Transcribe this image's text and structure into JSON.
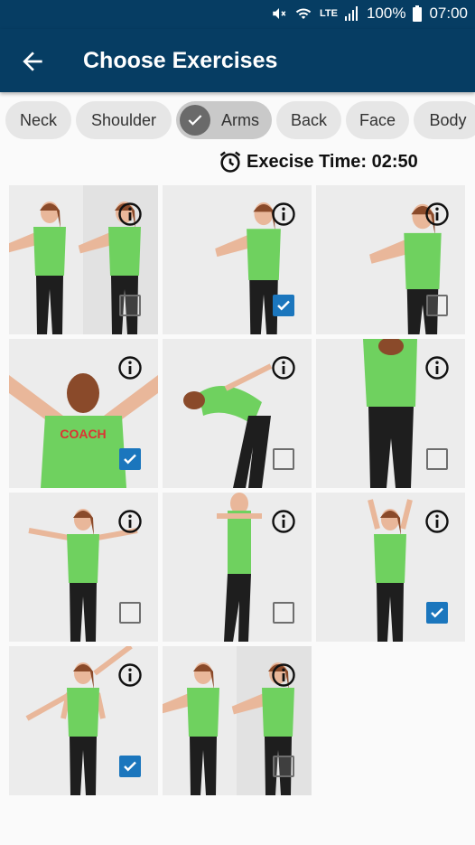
{
  "status": {
    "battery": "100%",
    "time": "07:00",
    "network": "LTE"
  },
  "appbar": {
    "title": "Choose Exercises",
    "back_icon": "arrow-back-icon"
  },
  "categories": [
    {
      "label": "Neck",
      "selected": false
    },
    {
      "label": "Shoulder",
      "selected": false
    },
    {
      "label": "Arms",
      "selected": true
    },
    {
      "label": "Back",
      "selected": false
    },
    {
      "label": "Face",
      "selected": false
    },
    {
      "label": "Body",
      "selected": false
    }
  ],
  "timer": {
    "label": "Execise Time: 02:50",
    "icon": "alarm-clock-icon"
  },
  "exercises": [
    {
      "checked": false,
      "pose": "split"
    },
    {
      "checked": true,
      "pose": "arms-forward"
    },
    {
      "checked": false,
      "pose": "arms-forward-close"
    },
    {
      "checked": true,
      "pose": "back-arms-up"
    },
    {
      "checked": false,
      "pose": "bend-forward"
    },
    {
      "checked": false,
      "pose": "arms-behind-head"
    },
    {
      "checked": false,
      "pose": "arms-side"
    },
    {
      "checked": false,
      "pose": "side-stand"
    },
    {
      "checked": true,
      "pose": "arms-overhead"
    },
    {
      "checked": true,
      "pose": "arms-diagonal"
    },
    {
      "checked": false,
      "pose": "split2"
    }
  ],
  "colors": {
    "primary": "#063d63",
    "checkbox": "#1b76bd",
    "shirt": "#6fd15f",
    "pants": "#1e1e1e"
  }
}
